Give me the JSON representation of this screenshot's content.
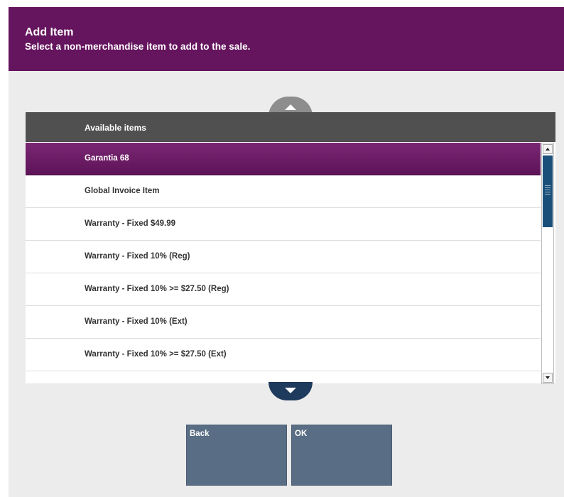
{
  "header": {
    "title": "Add Item",
    "subtitle": "Select a non-merchandise item to add to the sale."
  },
  "list": {
    "header": "Available items",
    "items": [
      {
        "label": "Garantia 68",
        "selected": true
      },
      {
        "label": "Global Invoice Item",
        "selected": false
      },
      {
        "label": "Warranty - Fixed $49.99",
        "selected": false
      },
      {
        "label": "Warranty - Fixed 10% (Reg)",
        "selected": false
      },
      {
        "label": "Warranty - Fixed 10% >= $27.50 (Reg)",
        "selected": false
      },
      {
        "label": "Warranty - Fixed 10% (Ext)",
        "selected": false
      },
      {
        "label": "Warranty - Fixed 10% >= $27.50 (Ext)",
        "selected": false
      }
    ]
  },
  "buttons": {
    "back_label": "Back",
    "ok_label": "OK"
  },
  "icons": {
    "scroll_up": "chevron-up-icon",
    "scroll_down": "chevron-down-icon"
  },
  "colors": {
    "header_bg": "#65145e",
    "selected_row": "#6a1a63",
    "button_bg": "#596d84",
    "scroll_thumb": "#1a4f7a"
  }
}
